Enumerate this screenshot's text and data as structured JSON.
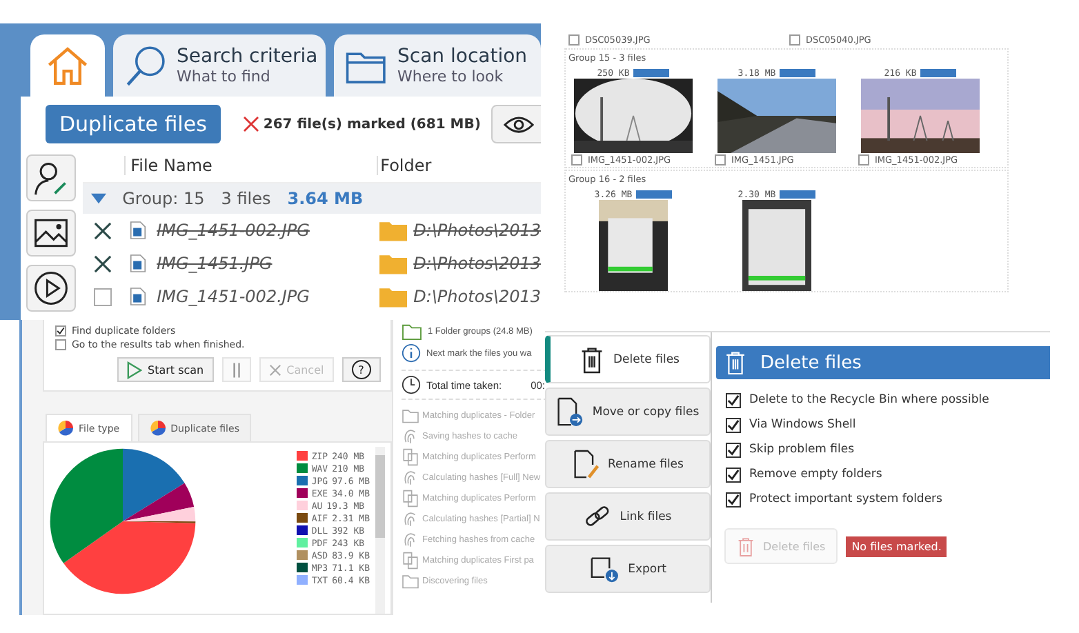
{
  "results_panel": {
    "tabs": [
      {
        "kind": "home",
        "selected": true
      },
      {
        "kind": "search",
        "title": "Search criteria",
        "subtitle": "What to find",
        "selected": false
      },
      {
        "kind": "folder",
        "title": "Scan location",
        "subtitle": "Where to look",
        "selected": false
      }
    ],
    "mode_button": "Duplicate files",
    "marked_summary": "267 file(s) marked (681 MB)",
    "columns": [
      "File Name",
      "Folder"
    ],
    "group": {
      "label": "Group: 15",
      "count": "3 files",
      "size": "3.64 MB",
      "expanded": true
    },
    "rows": [
      {
        "name": "IMG_1451-002.JPG",
        "folder": "D:\\Photos\\2013",
        "marked": true
      },
      {
        "name": "IMG_1451.JPG",
        "folder": "D:\\Photos\\2013",
        "marked": true
      },
      {
        "name": "IMG_1451-002.JPG",
        "folder": "D:\\Photos\\2013",
        "marked": false
      }
    ]
  },
  "thumbnail_panel": {
    "top_files": [
      {
        "name": "DSC05039.JPG",
        "checked": false
      },
      {
        "name": "DSC05040.JPG",
        "checked": false
      }
    ],
    "groups": [
      {
        "title": "Group 15  -  3 files",
        "items": [
          {
            "size": "250 KB",
            "name": "IMG_1451-002.JPG",
            "checked": false
          },
          {
            "size": "3.18 MB",
            "name": "IMG_1451.JPG",
            "checked": false
          },
          {
            "size": "216 KB",
            "name": "IMG_1451-002.JPG",
            "checked": false
          }
        ]
      },
      {
        "title": "Group 16  -  2 files",
        "items": [
          {
            "size": "3.26 MB"
          },
          {
            "size": "2.30 MB"
          }
        ]
      }
    ]
  },
  "scan_panel": {
    "options": [
      {
        "label": "Find duplicate folders",
        "checked": true
      },
      {
        "label": "Go to the results tab when finished.",
        "checked": false
      }
    ],
    "buttons": [
      {
        "kind": "start",
        "label": "Start scan",
        "disabled": false
      },
      {
        "kind": "pause",
        "disabled": true
      },
      {
        "kind": "cancel",
        "label": "Cancel",
        "disabled": true
      },
      {
        "kind": "help",
        "label": "?",
        "disabled": false
      }
    ],
    "chart_tabs": [
      {
        "label": "File type",
        "selected": true
      },
      {
        "label": "Duplicate files",
        "selected": false
      }
    ],
    "chart_data": {
      "type": "pie",
      "categories": [
        "ZIP",
        "WAV",
        "JPG",
        "EXE",
        "AU",
        "AIF"
      ],
      "values": [
        39.79,
        34.81,
        16.18,
        5.64,
        3.2,
        0.38
      ]
    },
    "legend": [
      {
        "value_label": "240 MB",
        "color": "#ff4040"
      },
      {
        "value_label": "210 MB",
        "color": "#008c40"
      },
      {
        "value_label": "97.6 MB",
        "color": "#1a6fb0"
      },
      {
        "value_label": "34.0 MB",
        "color": "#a0005a"
      },
      {
        "value_label": "19.3 MB",
        "color": "#ffd0dc"
      },
      {
        "value_label": "2.31 MB",
        "color": "#7a4a10"
      },
      {
        "label": "DLL",
        "value_label": "392 KB",
        "color": "#1010b0"
      },
      {
        "label": "PDF",
        "value_label": "243 KB",
        "color": "#60f0a0"
      },
      {
        "label": "ASD",
        "value_label": "83.9 KB",
        "color": "#b09060"
      },
      {
        "label": "MP3",
        "value_label": "71.1 KB",
        "color": "#005040"
      },
      {
        "label": "TXT",
        "value_label": "60.4 KB",
        "color": "#90b0ff"
      }
    ],
    "summary": [
      {
        "kind": "folder",
        "text": "1 Folder groups (24.8 MB)"
      },
      {
        "kind": "info",
        "text": "Next mark the files you wa"
      }
    ],
    "time_label": "Total time taken:",
    "time_value": "00:",
    "steps": [
      {
        "kind": "folder",
        "text": "Matching duplicates - Folder"
      },
      {
        "kind": "hash",
        "text": "Saving hashes to cache"
      },
      {
        "kind": "docs",
        "text": "Matching duplicates Perform"
      },
      {
        "kind": "hash",
        "text": "Calculating hashes [Full] New"
      },
      {
        "kind": "docs",
        "text": "Matching duplicates Perform"
      },
      {
        "kind": "hash",
        "text": "Calculating hashes [Partial] N"
      },
      {
        "kind": "hash",
        "text": "Fetching hashes from cache"
      },
      {
        "kind": "docs",
        "text": "Matching duplicates First pa"
      },
      {
        "kind": "folder",
        "text": "Discovering files"
      }
    ]
  },
  "delete_panel": {
    "nav": [
      {
        "kind": "trash",
        "label": "Delete files",
        "selected": true
      },
      {
        "kind": "move",
        "label": "Move or copy files",
        "selected": false
      },
      {
        "kind": "rename",
        "label": "Rename files",
        "selected": false
      },
      {
        "kind": "link",
        "label": "Link files",
        "selected": false
      },
      {
        "kind": "export",
        "label": "Export",
        "selected": false
      }
    ],
    "header": "Delete files",
    "options": [
      {
        "label": "Delete to the Recycle Bin where possible",
        "checked": true
      },
      {
        "label": "Via Windows Shell",
        "checked": true
      },
      {
        "label": "Skip problem files",
        "checked": true
      },
      {
        "label": "Remove empty folders",
        "checked": true
      },
      {
        "label": "Protect important system folders",
        "checked": true
      }
    ],
    "action": {
      "label": "Delete files",
      "disabled": true
    },
    "status": "No files marked."
  }
}
